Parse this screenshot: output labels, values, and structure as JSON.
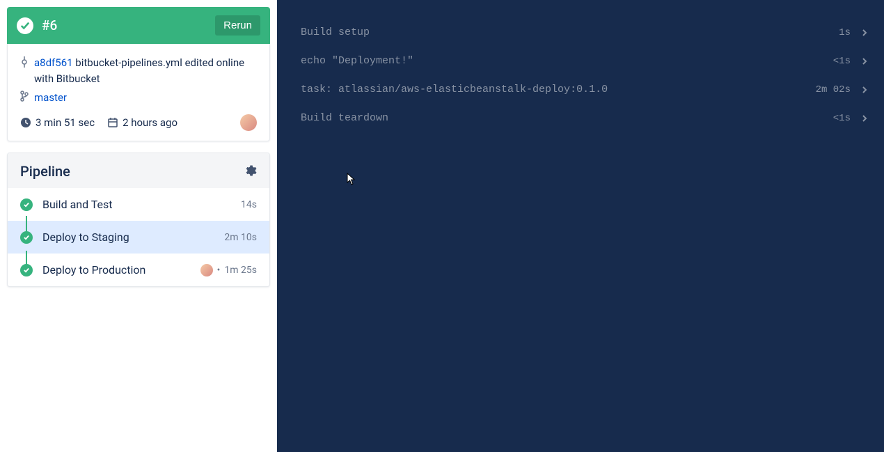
{
  "build": {
    "id": "#6",
    "rerun_label": "Rerun",
    "commit_hash": "a8df561",
    "commit_msg": "bitbucket-pipelines.yml edited online with Bitbucket",
    "branch": "master",
    "duration": "3 min 51 sec",
    "when": "2 hours ago"
  },
  "pipeline": {
    "title": "Pipeline",
    "steps": [
      {
        "label": "Build and Test",
        "time": "14s",
        "selected": false,
        "has_avatar": false
      },
      {
        "label": "Deploy to Staging",
        "time": "2m 10s",
        "selected": true,
        "has_avatar": false
      },
      {
        "label": "Deploy to Production",
        "time": "1m 25s",
        "selected": false,
        "has_avatar": true,
        "bullet": "•"
      }
    ]
  },
  "logs": [
    {
      "text": "Build setup",
      "time": "1s"
    },
    {
      "text": "echo \"Deployment!\"",
      "time": "<1s"
    },
    {
      "text": "task: atlassian/aws-elasticbeanstalk-deploy:0.1.0",
      "time": "2m 02s"
    },
    {
      "text": "Build teardown",
      "time": "<1s"
    }
  ]
}
